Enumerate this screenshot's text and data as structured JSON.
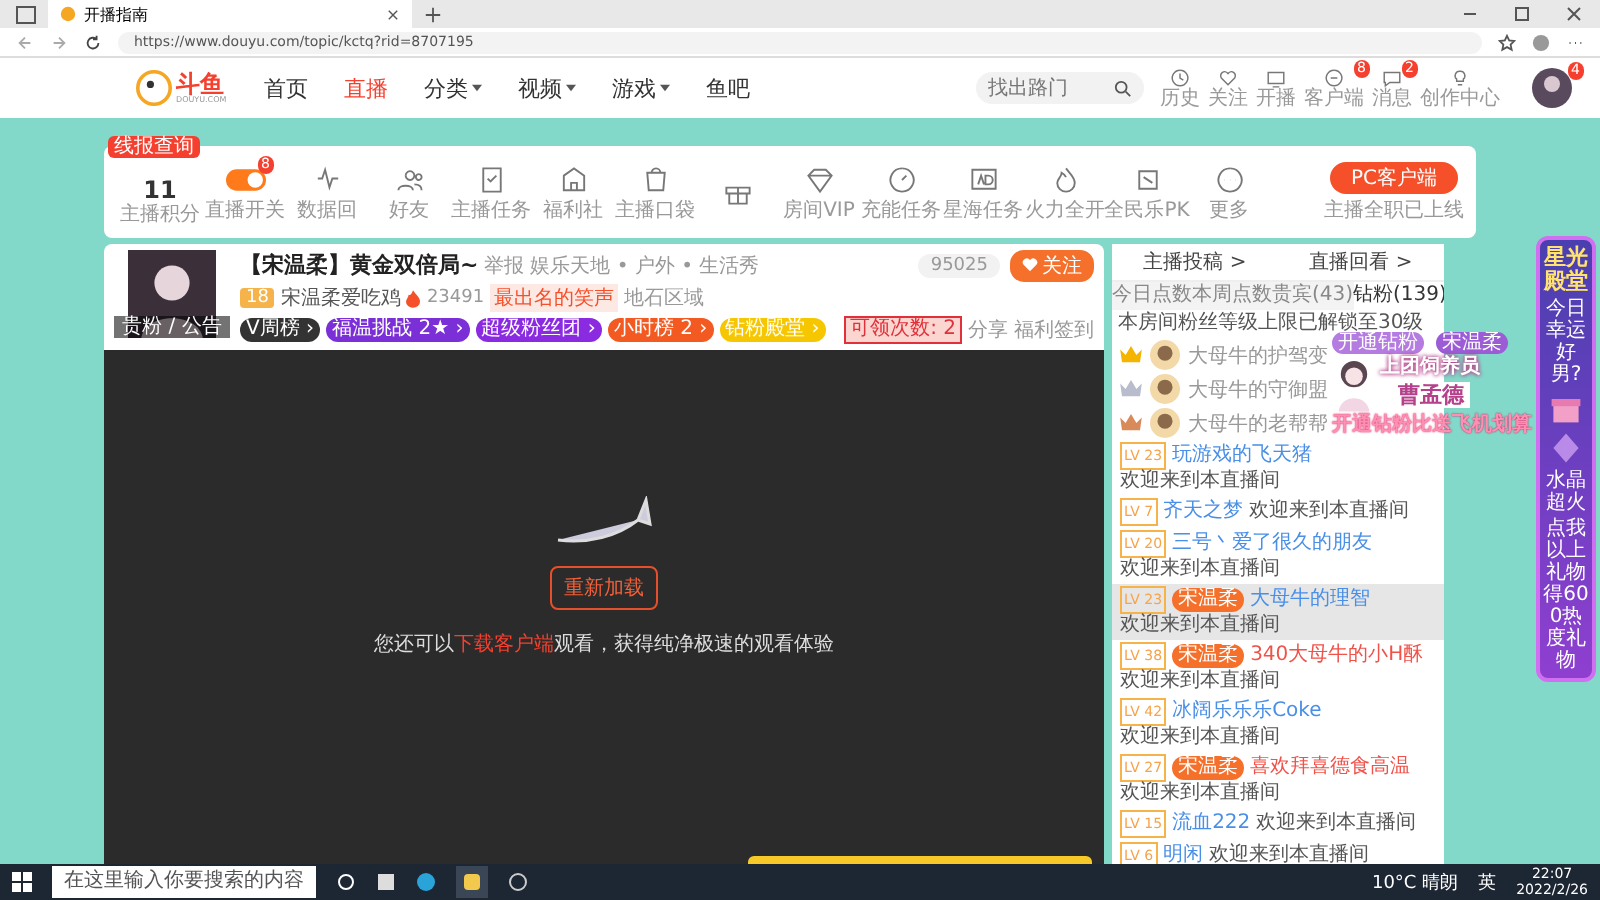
{
  "browser": {
    "tab_title": "开播指南",
    "url": "https://www.douyu.com/topic/kctq?rid=8707195"
  },
  "header": {
    "logo": "斗鱼",
    "logo_sub": "DOUYU.COM",
    "nav": [
      {
        "label": "首页",
        "dropdown": false,
        "selected": false
      },
      {
        "label": "直播",
        "dropdown": false,
        "selected": true
      },
      {
        "label": "分类",
        "dropdown": true,
        "selected": false
      },
      {
        "label": "视频",
        "dropdown": true,
        "selected": false
      },
      {
        "label": "游戏",
        "dropdown": true,
        "selected": false
      },
      {
        "label": "鱼吧",
        "dropdown": false,
        "selected": false
      }
    ],
    "search": {
      "placeholder": "找出路门"
    },
    "actions": [
      {
        "label": "历史"
      },
      {
        "label": "关注"
      },
      {
        "label": "开播"
      },
      {
        "label": "客户端",
        "badge": "8"
      },
      {
        "label": "消息",
        "badge": "2"
      },
      {
        "label": "创作中心"
      }
    ],
    "avatar_badge": "4"
  },
  "toolbar": {
    "tag": "线报查询",
    "points": "11",
    "points_label": "主播积分",
    "items": [
      {
        "kind": "toggle",
        "label": "直播开关",
        "badge": "8",
        "on": true
      },
      {
        "kind": "icon",
        "label": "数据回"
      },
      {
        "kind": "icon",
        "label": "好友"
      },
      {
        "kind": "icon",
        "label": "主播任务"
      },
      {
        "kind": "icon",
        "label": "福利社"
      },
      {
        "kind": "icon",
        "label": "主播口袋"
      },
      {
        "kind": "icon"
      },
      {
        "kind": "icon",
        "label": "房间VIP"
      },
      {
        "kind": "icon",
        "label": "充能任务"
      },
      {
        "kind": "icon",
        "label": "星海任务"
      },
      {
        "kind": "icon",
        "label": "火力全开"
      },
      {
        "kind": "icon",
        "label": "全民乐PK"
      },
      {
        "kind": "icon",
        "label": "更多"
      }
    ],
    "pc_button": "PC客户端",
    "pc_note": "主播全职已上线"
  },
  "room": {
    "title": "【宋温柔】黄金双倍局~",
    "report": "举报",
    "category": "娱乐天地 • 户外 • 生活秀",
    "level": "18",
    "name": "宋温柔爱吃鸡",
    "heat": "23491",
    "slogan": "最出名的笑声",
    "region": "地石区域",
    "avatar_tag": "贵粉 / 公告",
    "tags": [
      {
        "label": "V周榜 ›",
        "color": "#333333"
      },
      {
        "label": "福温挑战 2★ ›",
        "color": "#7b2fd6"
      },
      {
        "label": "超级粉丝团 ›",
        "color": "#8a2be2"
      },
      {
        "label": "小时榜 2 ›",
        "color": "#f25a22"
      },
      {
        "label": "钻粉殿堂 ›",
        "color": "#f6c700"
      }
    ],
    "claim": "可领次数: 2",
    "share": "分享",
    "sign": "福利签到",
    "followers": "95025",
    "follow": "关注"
  },
  "player": {
    "reload": "重新加载",
    "hint_before": "您还可以",
    "hint_link": "下载客户端",
    "hint_after": "观看，获得纯净极速的观看体验"
  },
  "chat": {
    "links": [
      "主播投稿 >",
      "直播回看 >"
    ],
    "tabs": [
      {
        "label": "今日点数",
        "selected": false
      },
      {
        "label": "本周点数",
        "selected": false
      },
      {
        "label": "贵宾(43)",
        "selected": false
      },
      {
        "label": "钻粉(139)",
        "selected": true
      }
    ],
    "notice": "本房间粉丝等级上限已解锁至30级",
    "ranks": [
      "大母牛的护驾变",
      "大母牛的守御盟",
      "大母牛的老帮帮"
    ],
    "overlay": {
      "badge": "开通钻粉",
      "line1": "上团饲养员",
      "line2": "曹孟德",
      "line3": "开通钻粉比送飞机划算",
      "tag": "宋温柔"
    },
    "messages": [
      {
        "lv": "LV 23",
        "name": "玩游戏的飞天猪",
        "text": "欢迎来到本直播间",
        "color": "#4a8fe7",
        "highlight": false
      },
      {
        "lv": "LV 7",
        "name": "齐天之梦",
        "text": "欢迎来到本直播间",
        "color": "#4a8fe7",
        "highlight": false
      },
      {
        "lv": "LV 20",
        "name": "三号丶爱了很久的朋友",
        "text": "欢迎来到本直播间",
        "color": "#4a8fe7",
        "highlight": false
      },
      {
        "lv": "LV 23",
        "name": "大母牛的理智",
        "text": "欢迎来到本直播间",
        "color": "#4a8fe7",
        "medal": "宋温柔",
        "highlight": true
      },
      {
        "lv": "LV 38",
        "name": "340大母牛的小H酥",
        "text": "欢迎来到本直播间",
        "color": "#f0524a",
        "medal": "宋温柔",
        "highlight": false
      },
      {
        "lv": "LV 42",
        "name": "冰阔乐乐乐Coke",
        "text": "欢迎来到本直播间",
        "color": "#4a8fe7",
        "highlight": false
      },
      {
        "lv": "LV 27",
        "name": "喜欢拜喜德食高温",
        "text": "欢迎来到本直播间",
        "color": "#f0524a",
        "medal": "宋温柔",
        "highlight": false
      },
      {
        "lv": "LV 15",
        "name": "流血222",
        "text": "欢迎来到本直播间",
        "color": "#4a8fe7",
        "highlight": false
      },
      {
        "lv": "LV 6",
        "name": "明闲",
        "text": "欢迎来到本直播间",
        "color": "#4a8fe7",
        "highlight": false
      }
    ]
  },
  "promo": {
    "title": "星光殿堂",
    "sub": "今日幸运好男?",
    "gift": "水晶超火",
    "note": "点我以上礼物得600热度礼物"
  },
  "taskbar": {
    "search": "在这里输入你要搜索的内容",
    "weather": "10°C 晴朗",
    "ime": "英",
    "time": "22:07",
    "date": "2022/2/26"
  }
}
